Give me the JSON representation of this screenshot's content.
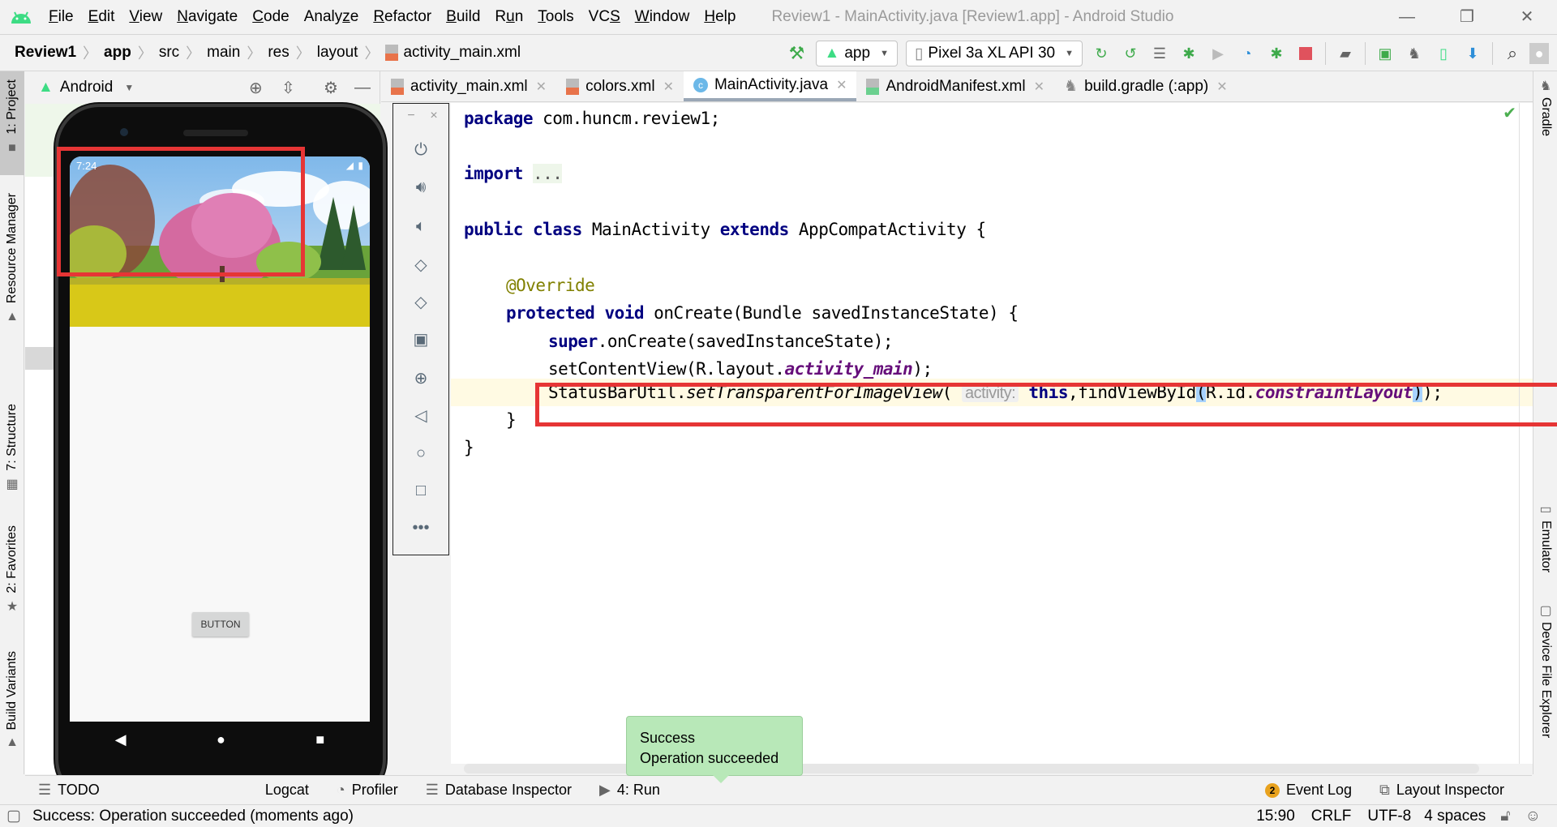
{
  "window": {
    "title": "Review1 - MainActivity.java [Review1.app] - Android Studio",
    "controls": {
      "minimize": "—",
      "restore": "❐",
      "close": "✕"
    }
  },
  "menu": [
    {
      "label": "File",
      "mnemonic": "F"
    },
    {
      "label": "Edit",
      "mnemonic": "E"
    },
    {
      "label": "View",
      "mnemonic": "V"
    },
    {
      "label": "Navigate",
      "mnemonic": "N"
    },
    {
      "label": "Code",
      "mnemonic": "C"
    },
    {
      "label": "Analyze",
      "mnemonic": "z"
    },
    {
      "label": "Refactor",
      "mnemonic": "R"
    },
    {
      "label": "Build",
      "mnemonic": "B"
    },
    {
      "label": "Run",
      "mnemonic": "u"
    },
    {
      "label": "Tools",
      "mnemonic": "T"
    },
    {
      "label": "VCS",
      "mnemonic": "S"
    },
    {
      "label": "Window",
      "mnemonic": "W"
    },
    {
      "label": "Help",
      "mnemonic": "H"
    }
  ],
  "breadcrumb": [
    "Review1",
    "app",
    "src",
    "main",
    "res",
    "layout",
    "activity_main.xml"
  ],
  "toolbar": {
    "run_config": "app",
    "device": "Pixel 3a XL API 30",
    "icons": [
      "hammer-icon",
      "apply-changes-icon",
      "apply-code-changes-icon",
      "sync-icon",
      "debug-icon",
      "attach-debugger-icon",
      "profile-icon",
      "attach-profiler-icon",
      "stop-icon",
      "project-structure-icon",
      "terminal-icon",
      "gradle-sync-icon",
      "avd-manager-icon",
      "sdk-manager-icon",
      "search-icon",
      "user-icon"
    ],
    "colors": {
      "green": "#3daa4a",
      "stop": "#e0525d",
      "blue": "#2f8fd8"
    }
  },
  "project_panel": {
    "view": "Android"
  },
  "left_strip": [
    {
      "label": "1: Project",
      "icon": "folder-icon"
    },
    {
      "label": "Resource Manager",
      "icon": "resource-icon"
    },
    {
      "label": "7: Structure",
      "icon": "structure-icon"
    },
    {
      "label": "2: Favorites",
      "icon": "star-icon"
    },
    {
      "label": "Build Variants",
      "icon": "android-icon"
    }
  ],
  "right_strip": [
    {
      "label": "Gradle",
      "icon": "gradle-icon"
    },
    {
      "label": "Emulator",
      "icon": "emulator-icon"
    },
    {
      "label": "Device File Explorer",
      "icon": "device-icon"
    }
  ],
  "tabs": [
    {
      "label": "activity_main.xml",
      "type": "xml",
      "active": false
    },
    {
      "label": "colors.xml",
      "type": "xml",
      "active": false
    },
    {
      "label": "MainActivity.java",
      "type": "class",
      "active": true
    },
    {
      "label": "AndroidManifest.xml",
      "type": "manifest",
      "active": false
    },
    {
      "label": "build.gradle (:app)",
      "type": "gradle",
      "active": false
    }
  ],
  "emulator_controls": {
    "minimize": "−",
    "close": "×",
    "buttons": [
      "power",
      "volume-up",
      "volume-down",
      "rotate-left",
      "rotate-right",
      "screenshot",
      "zoom",
      "back",
      "home",
      "overview",
      "more"
    ]
  },
  "phone": {
    "status_time": "7:24",
    "button_label": "BUTTON"
  },
  "code": {
    "line1": {
      "kw": "package",
      "rest": " com.huncm.review1;"
    },
    "line2": {
      "kw": "import",
      "fold": "..."
    },
    "line3": {
      "kw1": "public",
      "kw2": "class",
      "name": " MainActivity ",
      "kw3": "extends",
      "rest": " AppCompatActivity {"
    },
    "line4": {
      "ann": "@Override"
    },
    "line5": {
      "kw1": "protected",
      "kw2": "void",
      "rest": " onCreate(Bundle savedInstanceState) {"
    },
    "line6": {
      "kw": "super",
      "rest": ".onCreate(savedInstanceState);"
    },
    "line7": {
      "pre": "setContentView(R.layout.",
      "static": "activity_main",
      "post": ");"
    },
    "line8": {
      "cls": "StatusBarUtil.",
      "method": "setTransparentForImageView",
      "open": "( ",
      "hint": "activity:",
      "kw": "this",
      "mid": ",findViewById",
      "p1": "(",
      "rid": "R.id.",
      "field": "constraintLayout",
      "p2": ")",
      "end": ");"
    },
    "line9": "}",
    "line10": "}"
  },
  "toast": {
    "title": "Success",
    "message": "Operation succeeded"
  },
  "bottom_tools": {
    "todo": "TODO",
    "logcat": "Logcat",
    "profiler": "Profiler",
    "database": "Database Inspector",
    "run": "4: Run",
    "event_log": "Event Log",
    "event_count": "2",
    "layout_inspector": "Layout Inspector"
  },
  "status": {
    "message": "Success: Operation succeeded (moments ago)",
    "position": "15:90",
    "line_sep": "CRLF",
    "encoding": "UTF-8",
    "indent": "4 spaces"
  }
}
